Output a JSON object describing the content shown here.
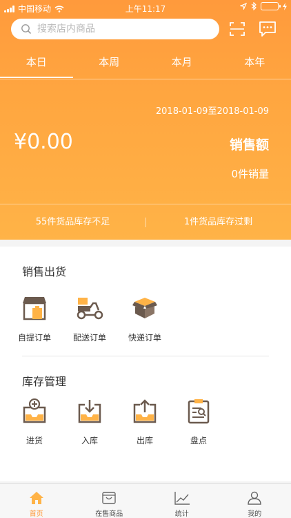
{
  "status": {
    "carrier": "中国移动",
    "time": "上午11:17"
  },
  "search": {
    "placeholder": "搜索店内商品"
  },
  "tabs": [
    {
      "label": "本日"
    },
    {
      "label": "本周"
    },
    {
      "label": "本月"
    },
    {
      "label": "本年"
    }
  ],
  "summary": {
    "date_range": "2018-01-09至2018-01-09",
    "amount": "¥0.00",
    "amount_label": "销售额",
    "sales_count": "0件销量"
  },
  "stock": {
    "low": "55件货品库存不足",
    "over": "1件货品库存过剩"
  },
  "sales_section": {
    "title": "销售出货",
    "items": [
      {
        "label": "自提订单",
        "icon": "store-icon"
      },
      {
        "label": "配送订单",
        "icon": "delivery-scooter-icon"
      },
      {
        "label": "快递订单",
        "icon": "parcel-box-icon"
      }
    ]
  },
  "inventory_section": {
    "title": "库存管理",
    "items": [
      {
        "label": "进货",
        "icon": "purchase-tray-icon"
      },
      {
        "label": "入库",
        "icon": "stock-in-icon"
      },
      {
        "label": "出库",
        "icon": "stock-out-icon"
      },
      {
        "label": "盘点",
        "icon": "stocktake-clipboard-icon"
      }
    ]
  },
  "tabbar": [
    {
      "label": "首页",
      "icon": "home-icon"
    },
    {
      "label": "在售商品",
      "icon": "shopping-bag-icon"
    },
    {
      "label": "统计",
      "icon": "chart-icon"
    },
    {
      "label": "我的",
      "icon": "user-icon"
    }
  ],
  "colors": {
    "accent": "#ff9a3c",
    "icon_dark": "#6b5a4e",
    "icon_orange": "#ffb347"
  }
}
